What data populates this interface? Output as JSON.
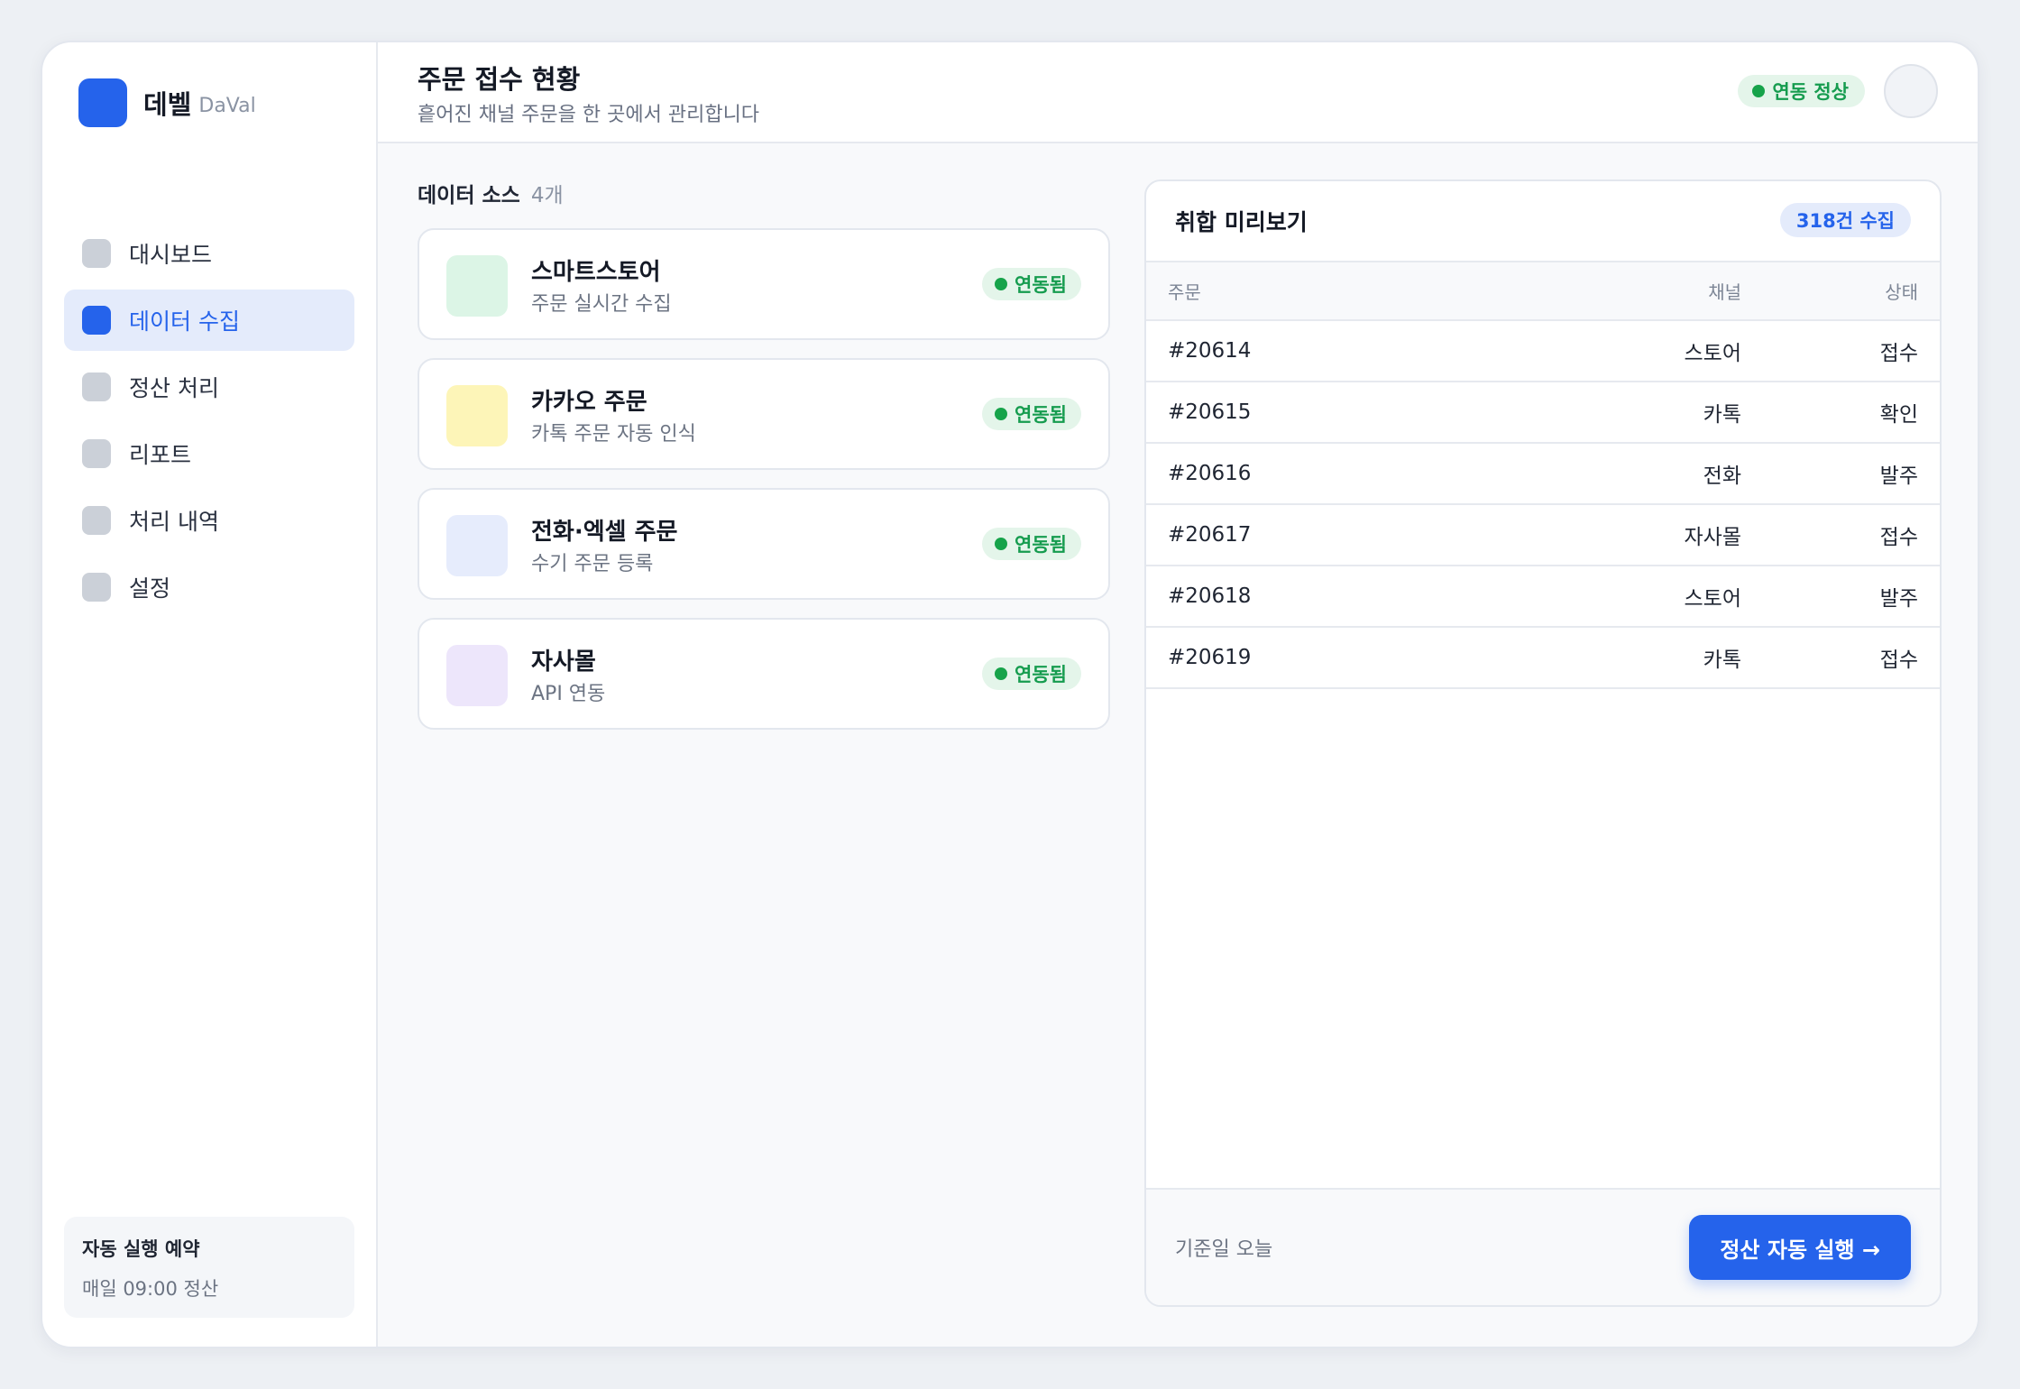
{
  "brand": {
    "name": "데벨",
    "sub": "DaVal"
  },
  "sidebar": {
    "items": [
      {
        "label": "대시보드"
      },
      {
        "label": "데이터 수집"
      },
      {
        "label": "정산 처리"
      },
      {
        "label": "리포트"
      },
      {
        "label": "처리 내역"
      },
      {
        "label": "설정"
      }
    ],
    "active_index": 1,
    "schedule": {
      "title": "자동 실행 예약",
      "desc": "매일 09:00 정산"
    }
  },
  "header": {
    "title": "주문 접수 현황",
    "subtitle": "흩어진 채널 주문을 한 곳에서 관리합니다",
    "status": "연동 정상"
  },
  "sources": {
    "heading": "데이터 소스",
    "count": "4개",
    "items": [
      {
        "name": "스마트스토어",
        "desc": "주문 실시간 수집",
        "status": "연동됨",
        "color": "#dcf5e6"
      },
      {
        "name": "카카오 주문",
        "desc": "카톡 주문 자동 인식",
        "status": "연동됨",
        "color": "#fdf5b8"
      },
      {
        "name": "전화·엑셀 주문",
        "desc": "수기 주문 등록",
        "status": "연동됨",
        "color": "#e6ecfc"
      },
      {
        "name": "자사몰",
        "desc": "API 연동",
        "status": "연동됨",
        "color": "#ede6fb"
      }
    ]
  },
  "preview": {
    "title": "취합 미리보기",
    "count": "318건 수집",
    "columns": {
      "order": "주문",
      "channel": "채널",
      "status": "상태"
    },
    "rows": [
      {
        "order": "#20614",
        "channel": "스토어",
        "status": "접수"
      },
      {
        "order": "#20615",
        "channel": "카톡",
        "status": "확인"
      },
      {
        "order": "#20616",
        "channel": "전화",
        "status": "발주"
      },
      {
        "order": "#20617",
        "channel": "자사몰",
        "status": "접수"
      },
      {
        "order": "#20618",
        "channel": "스토어",
        "status": "발주"
      },
      {
        "order": "#20619",
        "channel": "카톡",
        "status": "접수"
      }
    ],
    "foot_note": "기준일 오늘",
    "run_button": "정산 자동 실행 →"
  },
  "colors": {
    "accent": "#2563eb",
    "success": "#16a34a"
  }
}
